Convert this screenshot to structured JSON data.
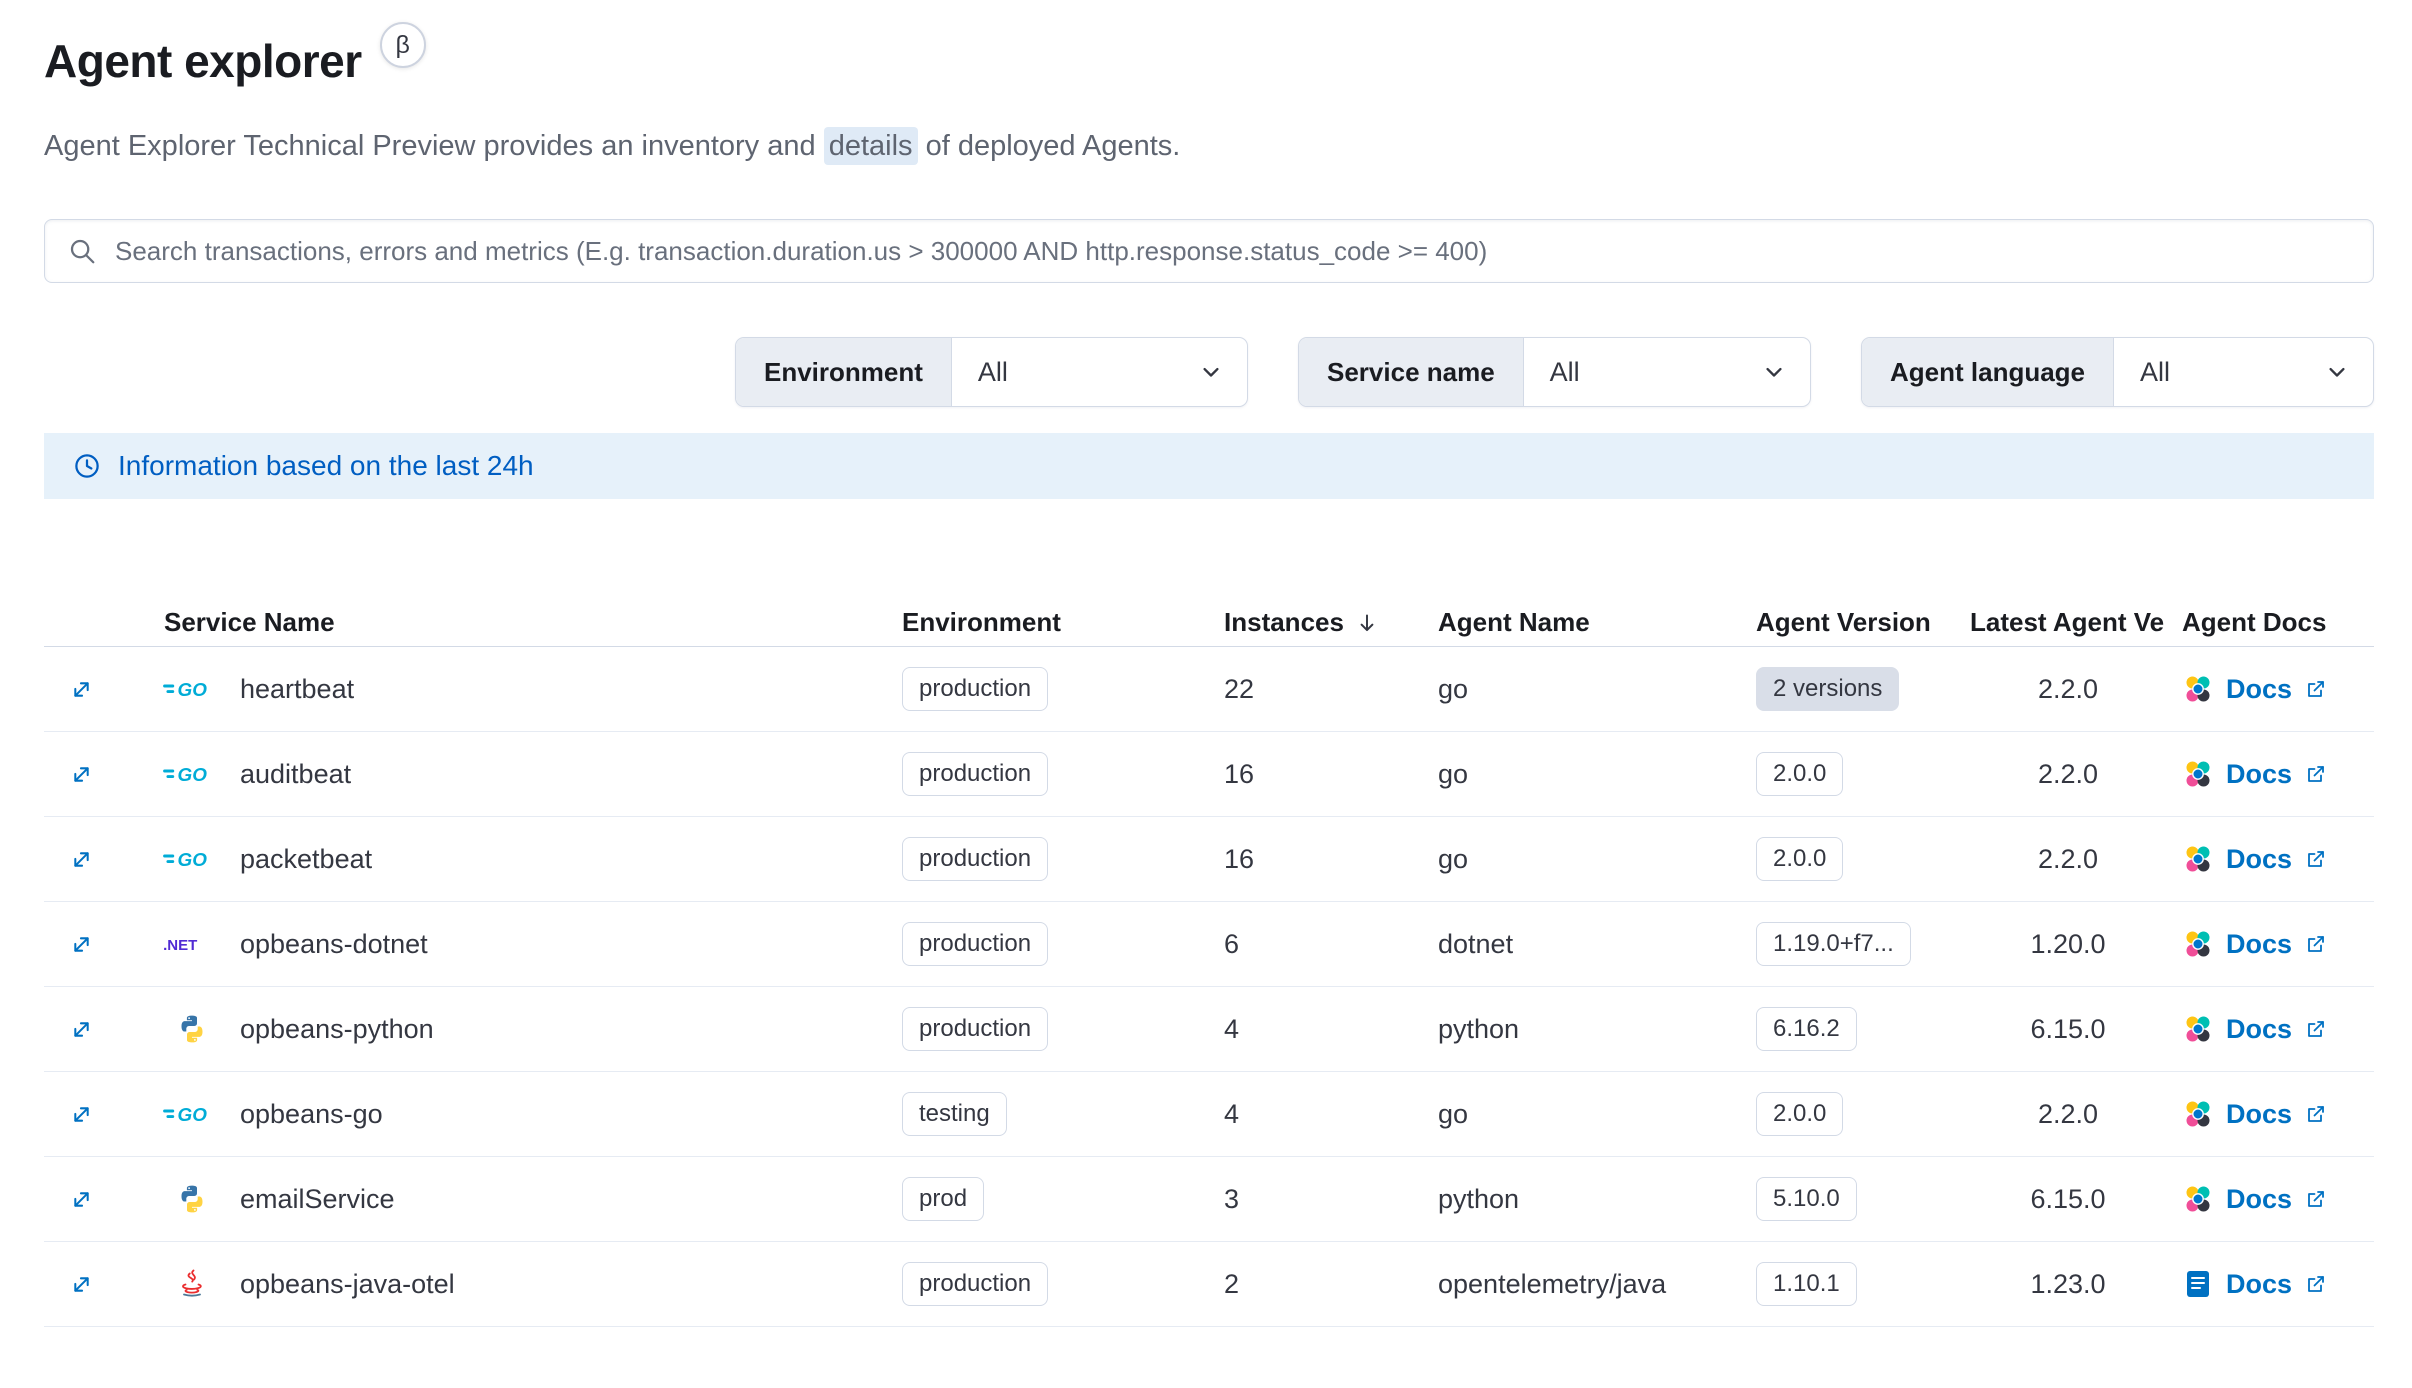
{
  "header": {
    "title": "Agent explorer",
    "beta_badge": "β",
    "subtitle_before": "Agent Explorer Technical Preview provides an inventory and ",
    "subtitle_highlight": "details",
    "subtitle_after": " of deployed Agents."
  },
  "search": {
    "placeholder": "Search transactions, errors and metrics (E.g. transaction.duration.us > 300000 AND http.response.status_code >= 400)"
  },
  "filters": [
    {
      "label": "Environment",
      "value": "All"
    },
    {
      "label": "Service name",
      "value": "All"
    },
    {
      "label": "Agent language",
      "value": "All"
    }
  ],
  "banner": {
    "text": "Information based on the last 24h"
  },
  "table": {
    "columns": {
      "service_name": "Service Name",
      "environment": "Environment",
      "instances": "Instances",
      "agent_name": "Agent Name",
      "agent_version": "Agent Version",
      "latest_agent_version": "Latest Agent Ve",
      "agent_docs": "Agent Docs"
    },
    "rows": [
      {
        "service": "heartbeat",
        "icon": "go-icon",
        "environment": "production",
        "instances": "22",
        "agent_name": "go",
        "agent_version": "2 versions",
        "version_badge": "filled",
        "latest_version": "2.2.0",
        "docs_label": "Docs",
        "docs_icon": "elastic-icon"
      },
      {
        "service": "auditbeat",
        "icon": "go-icon",
        "environment": "production",
        "instances": "16",
        "agent_name": "go",
        "agent_version": "2.0.0",
        "version_badge": "outline",
        "latest_version": "2.2.0",
        "docs_label": "Docs",
        "docs_icon": "elastic-icon"
      },
      {
        "service": "packetbeat",
        "icon": "go-icon",
        "environment": "production",
        "instances": "16",
        "agent_name": "go",
        "agent_version": "2.0.0",
        "version_badge": "outline",
        "latest_version": "2.2.0",
        "docs_label": "Docs",
        "docs_icon": "elastic-icon"
      },
      {
        "service": "opbeans-dotnet",
        "icon": "dotnet-icon",
        "environment": "production",
        "instances": "6",
        "agent_name": "dotnet",
        "agent_version": "1.19.0+f7...",
        "version_badge": "outline",
        "latest_version": "1.20.0",
        "docs_label": "Docs",
        "docs_icon": "elastic-icon"
      },
      {
        "service": "opbeans-python",
        "icon": "python-icon",
        "environment": "production",
        "instances": "4",
        "agent_name": "python",
        "agent_version": "6.16.2",
        "version_badge": "outline",
        "latest_version": "6.15.0",
        "docs_label": "Docs",
        "docs_icon": "elastic-icon"
      },
      {
        "service": "opbeans-go",
        "icon": "go-icon",
        "environment": "testing",
        "instances": "4",
        "agent_name": "go",
        "agent_version": "2.0.0",
        "version_badge": "outline",
        "latest_version": "2.2.0",
        "docs_label": "Docs",
        "docs_icon": "elastic-icon"
      },
      {
        "service": "emailService",
        "icon": "python-icon",
        "environment": "prod",
        "instances": "3",
        "agent_name": "python",
        "agent_version": "5.10.0",
        "version_badge": "outline",
        "latest_version": "6.15.0",
        "docs_label": "Docs",
        "docs_icon": "elastic-icon"
      },
      {
        "service": "opbeans-java-otel",
        "icon": "java-icon",
        "environment": "production",
        "instances": "2",
        "agent_name": "opentelemetry/java",
        "agent_version": "1.10.1",
        "version_badge": "outline",
        "latest_version": "1.23.0",
        "docs_label": "Docs",
        "docs_icon": "docs-icon"
      }
    ]
  },
  "colors": {
    "primary_link": "#0071c2",
    "banner_background": "#e6f1fa",
    "banner_text": "#005ec2",
    "border": "#d3dae6",
    "go_logo": "#00ACD7",
    "dotnet_logo": "#512BD4",
    "filled_badge_background": "#d9dee8"
  }
}
